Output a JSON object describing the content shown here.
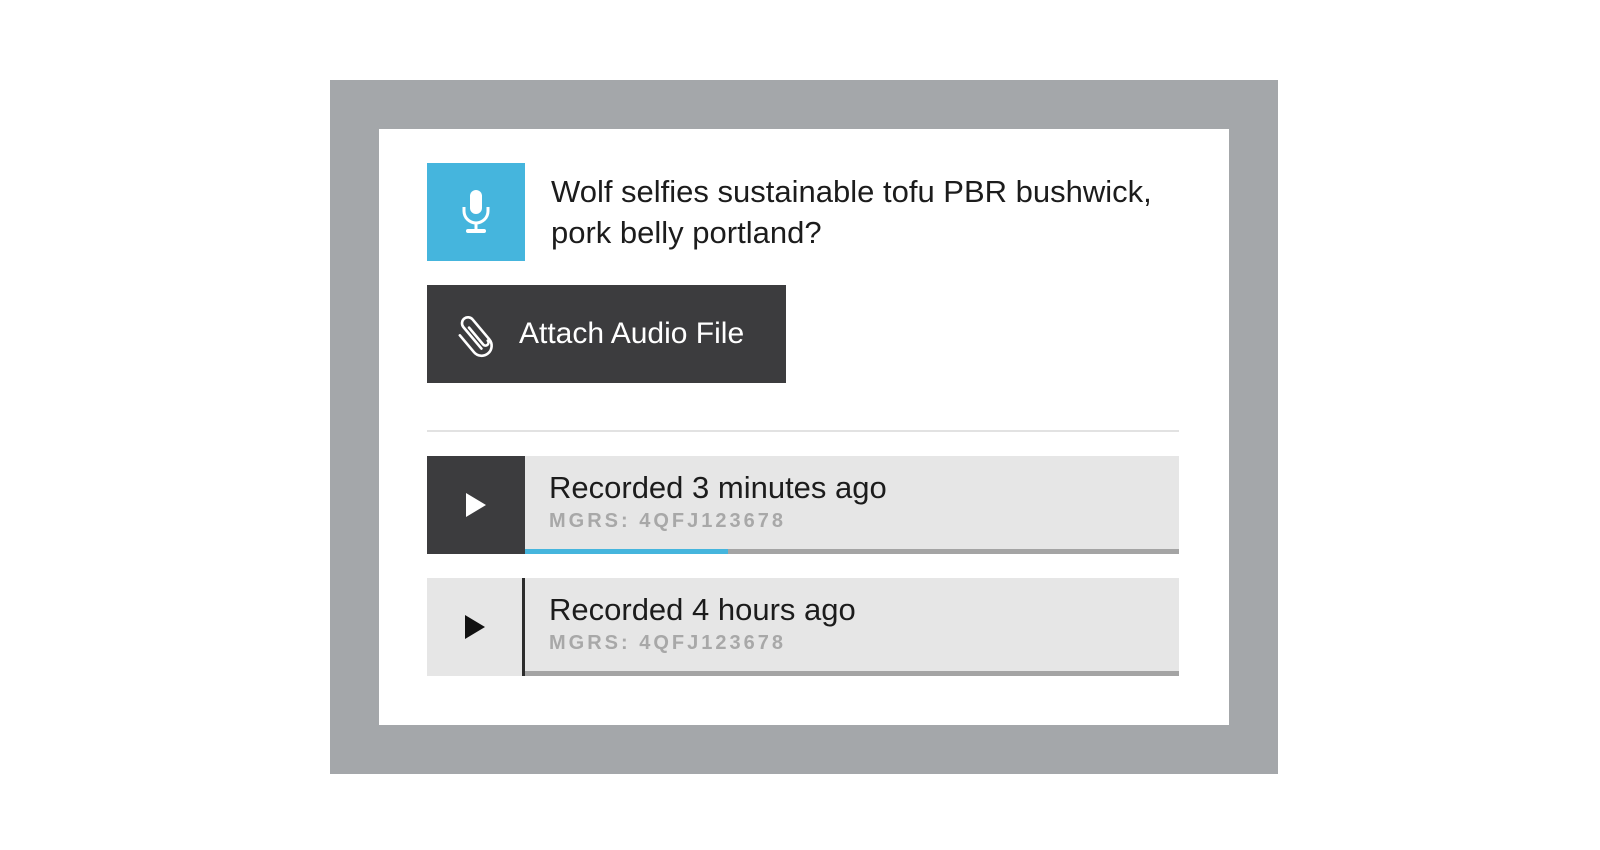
{
  "question": {
    "icon": "microphone-icon",
    "text": "Wolf selfies sustainable tofu PBR bushwick, pork belly portland?"
  },
  "attach": {
    "icon": "paperclip-icon",
    "label": "Attach Audio File"
  },
  "recordings": [
    {
      "title": "Recorded 3 minutes ago",
      "location": "MGRS: 4QFJ123678",
      "progress": 0.31,
      "active": true
    },
    {
      "title": "Recorded 4 hours ago",
      "location": "MGRS: 4QFJ123678",
      "progress": 0,
      "active": false
    }
  ],
  "colors": {
    "accent": "#45b5dd",
    "dark": "#3c3c3e",
    "frame": "#a4a7aa",
    "row": "#e6e6e6"
  }
}
